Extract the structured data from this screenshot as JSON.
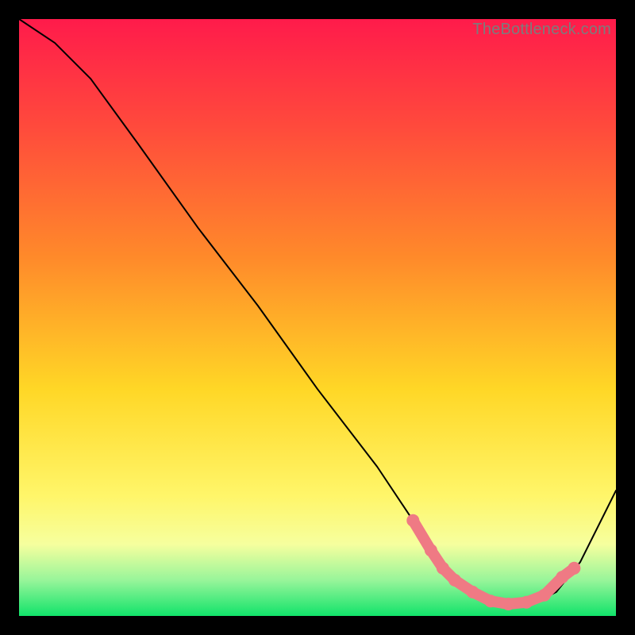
{
  "watermark": "TheBottleneck.com",
  "chart_data": {
    "type": "line",
    "title": "",
    "xlabel": "",
    "ylabel": "",
    "xlim": [
      0,
      100
    ],
    "ylim": [
      0,
      100
    ],
    "grid": false,
    "legend": false,
    "series": [
      {
        "name": "bottleneck-curve",
        "x": [
          0,
          6,
          12,
          20,
          30,
          40,
          50,
          60,
          66,
          70,
          74,
          78,
          82,
          86,
          90,
          94,
          100
        ],
        "y": [
          100,
          96,
          90,
          79,
          65,
          52,
          38,
          25,
          16,
          10,
          6,
          3,
          2,
          2,
          4,
          9,
          21
        ]
      }
    ],
    "marker_cluster": {
      "name": "optimal-range-dots",
      "color": "#ef7a84",
      "points": [
        {
          "x": 66,
          "y": 16
        },
        {
          "x": 69,
          "y": 11
        },
        {
          "x": 71,
          "y": 8
        },
        {
          "x": 73,
          "y": 6
        },
        {
          "x": 76,
          "y": 4
        },
        {
          "x": 79,
          "y": 2.5
        },
        {
          "x": 82,
          "y": 2
        },
        {
          "x": 85,
          "y": 2.3
        },
        {
          "x": 88,
          "y": 3.5
        },
        {
          "x": 91,
          "y": 6.5
        },
        {
          "x": 93,
          "y": 8
        }
      ]
    }
  }
}
